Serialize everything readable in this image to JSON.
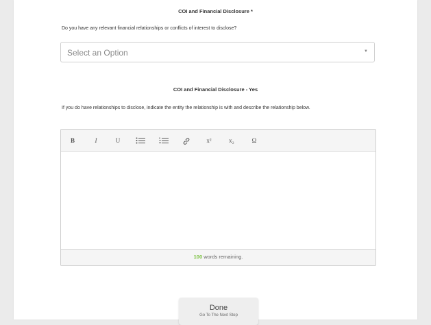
{
  "coi_section": {
    "heading": "COI and Financial Disclosure *",
    "question": "Do you have any relevant financial relationships or conflicts of interest to disclose?",
    "select": {
      "value": "Select an Option"
    }
  },
  "yes_section": {
    "heading": "COI and Financial Disclosure - Yes",
    "instruction": "If you do have relationships to disclose, indicate the entity the relationship is with and describe the relationship below.",
    "toolbar": {
      "bold": "B",
      "italic": "I",
      "underline": "U",
      "superscript": "x²",
      "subscript": "x₂",
      "special_char": "Ω"
    },
    "word_count": {
      "number": "100",
      "suffix": " words remaining."
    }
  },
  "done_button": {
    "label": "Done",
    "sublabel": "Go To The Next Step"
  },
  "colors": {
    "word_count_accent": "#7cc242",
    "background": "#ebebeb"
  }
}
